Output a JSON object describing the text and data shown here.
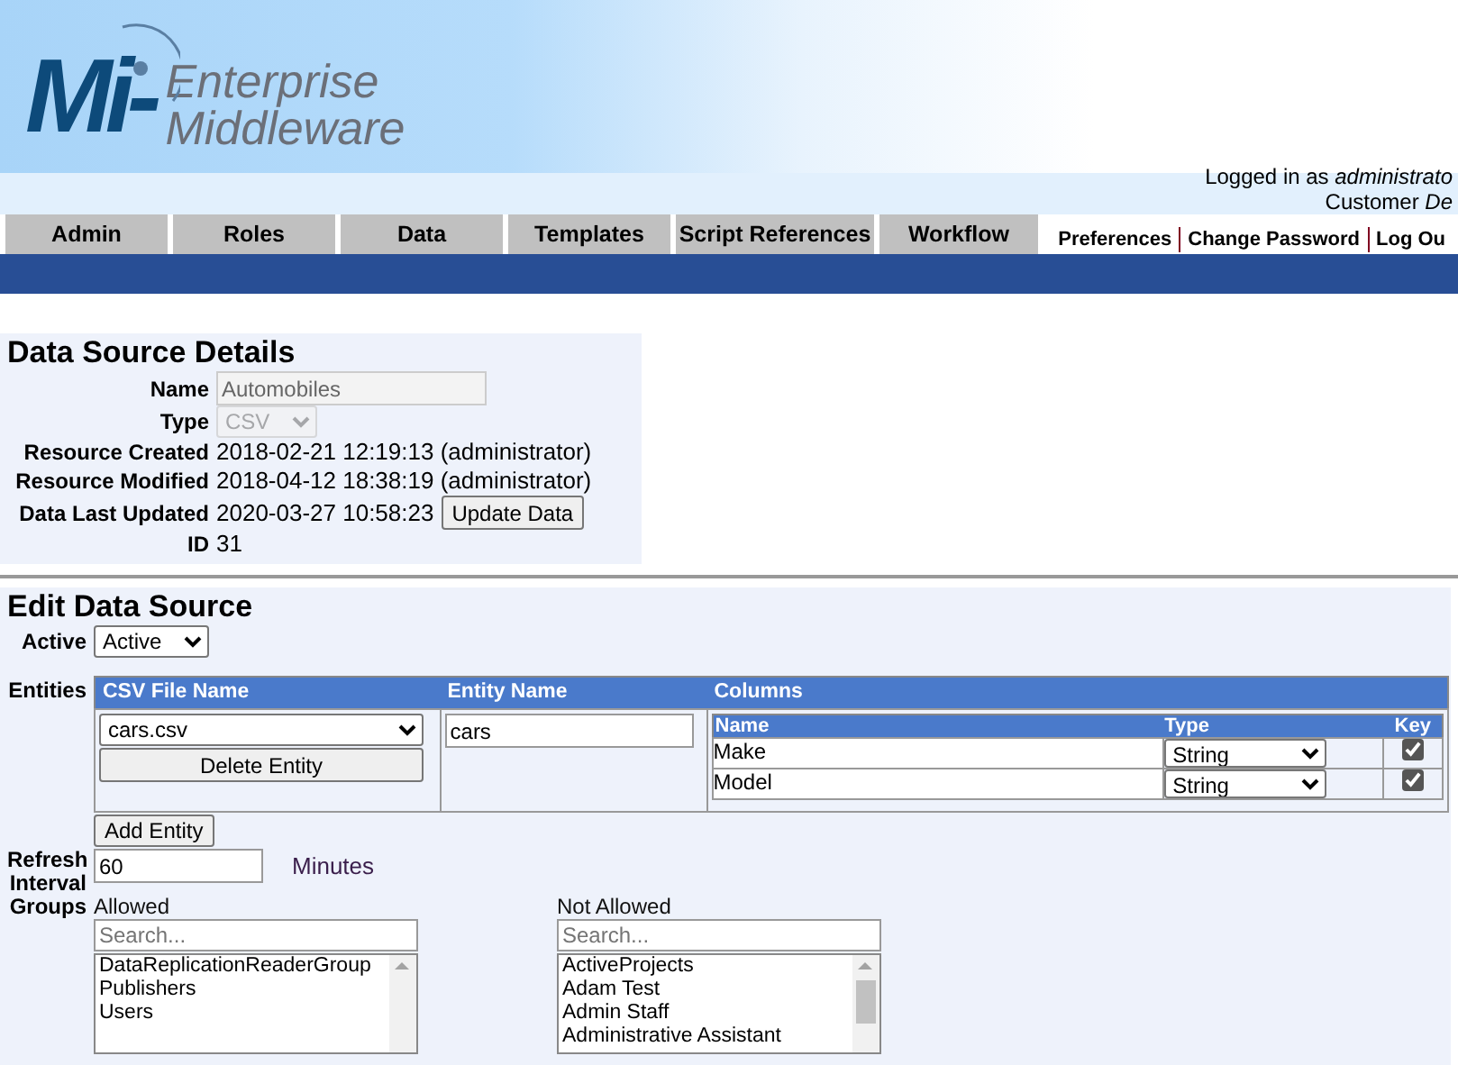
{
  "header": {
    "logo_mark": "Mi-",
    "logo_line_1": "Enterprise",
    "logo_line_2": "Middleware",
    "user_line": "Logged in as *administrato*",
    "org_line": "Customer *De*"
  },
  "tabs": [
    {
      "label": "Admin",
      "selected": false
    },
    {
      "label": "Roles",
      "selected": false
    },
    {
      "label": "Data",
      "selected": false
    },
    {
      "label": "Templates",
      "selected": false
    },
    {
      "label": "Script References",
      "selected": false
    },
    {
      "label": "Workflow",
      "selected": false
    }
  ],
  "user_links": [
    "Preferences",
    "Change Password",
    "Log Ou"
  ],
  "details": {
    "title": "Data Source Details",
    "fields": [
      {
        "label": "Name",
        "kind": "input",
        "value": "Automobiles",
        "disabled": true
      },
      {
        "label": "Type",
        "kind": "select",
        "value": "CSV",
        "disabled": true
      },
      {
        "label": "Resource Created",
        "kind": "text",
        "value": "2018-02-21 12:19:13 (administrator)"
      },
      {
        "label": "Resource Modified",
        "kind": "text",
        "value": "2018-04-12 18:38:19 (administrator)"
      },
      {
        "label": "Data Last Updated",
        "kind": "text_button",
        "value": "2020-03-27 10:58:23",
        "button": "Update Data"
      },
      {
        "label": "ID",
        "kind": "text",
        "value": "31"
      }
    ]
  },
  "edit": {
    "title": "Edit Data Source",
    "active": {
      "label": "Active",
      "value": "Active"
    },
    "entities": {
      "label": "Entities",
      "columns": [
        "CSV File Name",
        "Entity Name",
        "Columns"
      ],
      "rows": [
        {
          "file": "cars.csv",
          "delete_button": "Delete Entity",
          "entity_name": "cars",
          "column_headers": [
            "Name",
            "Type",
            "Key"
          ],
          "columns": [
            {
              "name": "Make",
              "type": "String",
              "key": true
            },
            {
              "name": "Model",
              "type": "String",
              "key": true
            }
          ]
        }
      ],
      "add_button": "Add Entity"
    },
    "refresh": {
      "label": "Refresh Interval",
      "value": "60",
      "unit": "Minutes"
    },
    "groups": {
      "label": "Groups",
      "lists": [
        {
          "title": "Allowed",
          "placeholder": "Search...",
          "items": [
            "DataReplicationReaderGroup",
            "Publishers",
            "Users"
          ]
        },
        {
          "title": "Not Allowed",
          "placeholder": "Search...",
          "items": [
            "ActiveProjects",
            "Adam Test",
            "Admin Staff",
            "Administrative Assistant"
          ]
        }
      ]
    }
  }
}
